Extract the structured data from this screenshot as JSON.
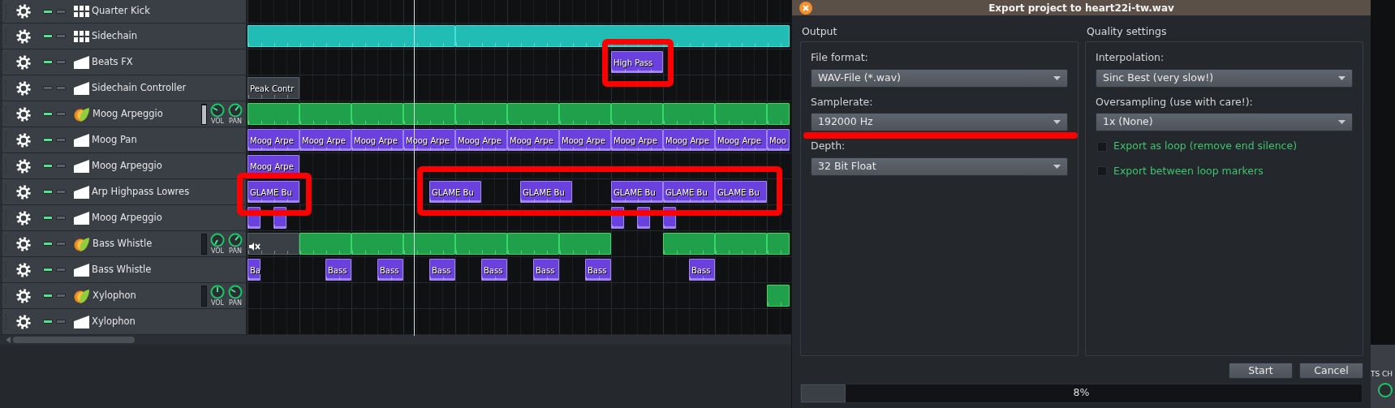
{
  "song_editor": {
    "tracks": [
      {
        "name": "Quarter Kick",
        "kind": "pattern",
        "muted": false,
        "solo": false
      },
      {
        "name": "Sidechain",
        "kind": "pattern",
        "muted": false,
        "solo": false,
        "clips": [
          {
            "kind": "beat"
          },
          {
            "kind": "beat"
          }
        ]
      },
      {
        "name": "Beats FX",
        "kind": "automation",
        "muted": false,
        "solo": false,
        "clips": [
          {
            "kind": "automation",
            "label": "High Pass"
          }
        ]
      },
      {
        "name": "Sidechain Controller",
        "kind": "automation",
        "muted": true,
        "solo": false,
        "clips": [
          {
            "kind": "automation",
            "label": "Peak Contr"
          }
        ]
      },
      {
        "name": "Moog Arpeggio",
        "kind": "instrument",
        "muted": false,
        "solo": false,
        "level": 0.95,
        "knobs": [
          {
            "label": "VOL"
          },
          {
            "label": "PAN"
          }
        ],
        "clips": [
          {
            "kind": "melody"
          },
          {
            "kind": "melody"
          },
          {
            "kind": "melody"
          },
          {
            "kind": "melody"
          },
          {
            "kind": "melody"
          },
          {
            "kind": "melody"
          },
          {
            "kind": "melody"
          },
          {
            "kind": "melody"
          },
          {
            "kind": "melody"
          },
          {
            "kind": "melody"
          },
          {
            "kind": "melody"
          }
        ]
      },
      {
        "name": "Moog Pan",
        "kind": "automation",
        "muted": false,
        "solo": false,
        "clips": [
          {
            "kind": "automation",
            "label": "Moog Arpe"
          },
          {
            "kind": "automation",
            "label": "Moog Arpe"
          },
          {
            "kind": "automation",
            "label": "Moog Arpe"
          },
          {
            "kind": "automation",
            "label": "Moog Arpe"
          },
          {
            "kind": "automation",
            "label": "Moog Arpe"
          },
          {
            "kind": "automation",
            "label": "Moog Arpe"
          },
          {
            "kind": "automation",
            "label": "Moog Arpe"
          },
          {
            "kind": "automation",
            "label": "Moog Arpe"
          },
          {
            "kind": "automation",
            "label": "Moog Arpe"
          },
          {
            "kind": "automation",
            "label": "Moog Arpe"
          },
          {
            "kind": "automation",
            "label": "Moo"
          }
        ]
      },
      {
        "name": "Moog Arpeggio",
        "kind": "automation",
        "muted": false,
        "solo": false,
        "clips": [
          {
            "kind": "automation",
            "label": "Moog Arpe"
          }
        ]
      },
      {
        "name": "Arp Highpass Lowres",
        "kind": "automation",
        "muted": false,
        "solo": false,
        "clips": [
          {
            "kind": "automation",
            "label": "GLAME Bu"
          },
          {
            "kind": "automation",
            "label": "GLAME Bu"
          },
          {
            "kind": "automation",
            "label": "GLAME Bu"
          },
          {
            "kind": "automation",
            "label": "GLAME Bu"
          },
          {
            "kind": "automation",
            "label": "GLAME Bu"
          },
          {
            "kind": "automation",
            "label": "GLAME Bu"
          }
        ]
      },
      {
        "name": "Moog Arpeggio",
        "kind": "automation",
        "muted": false,
        "solo": false,
        "clips": [
          {
            "kind": "automation"
          },
          {
            "kind": "automation"
          },
          {
            "kind": "automation"
          },
          {
            "kind": "automation"
          },
          {
            "kind": "automation"
          }
        ]
      },
      {
        "name": "Bass Whistle",
        "kind": "instrument",
        "muted": false,
        "solo": false,
        "level": 0,
        "knobs": [
          {
            "label": "VOL"
          },
          {
            "label": "PAN"
          }
        ],
        "clips": [
          {
            "kind": "melody",
            "muted": true
          },
          {
            "kind": "melody",
            "muted": false
          },
          {
            "kind": "melody",
            "muted": false
          },
          {
            "kind": "melody",
            "muted": false
          },
          {
            "kind": "melody",
            "muted": false
          },
          {
            "kind": "melody",
            "muted": false
          },
          {
            "kind": "melody",
            "muted": false
          },
          {
            "kind": "melody",
            "muted": false
          },
          {
            "kind": "melody",
            "muted": false
          },
          {
            "kind": "melody",
            "muted": false
          }
        ]
      },
      {
        "name": "Bass Whistle",
        "kind": "automation",
        "muted": false,
        "solo": false,
        "clips": [
          {
            "kind": "automation",
            "label": "Ba"
          },
          {
            "kind": "automation",
            "label": "Bass"
          },
          {
            "kind": "automation",
            "label": "Bass"
          },
          {
            "kind": "automation",
            "label": "Bass"
          },
          {
            "kind": "automation",
            "label": "Bass"
          },
          {
            "kind": "automation",
            "label": "Bass"
          },
          {
            "kind": "automation",
            "label": "Bass"
          },
          {
            "kind": "automation",
            "label": "Bass"
          }
        ]
      },
      {
        "name": "Xylophon",
        "kind": "instrument",
        "muted": false,
        "solo": false,
        "level": 0,
        "knobs": [
          {
            "label": "VOL"
          },
          {
            "label": "PAN"
          }
        ],
        "clips": [
          {
            "kind": "melody"
          }
        ]
      },
      {
        "name": "Xylophon",
        "kind": "automation",
        "muted": false,
        "solo": false
      }
    ]
  },
  "export_dialog": {
    "title": "Export project to heart22i-tw.wav",
    "output": {
      "heading": "Output",
      "fields": [
        {
          "label": "File format:",
          "value": "WAV-File (*.wav)"
        },
        {
          "label": "Samplerate:",
          "value": "192000 Hz"
        },
        {
          "label": "Depth:",
          "value": "32 Bit Float"
        }
      ]
    },
    "quality": {
      "heading": "Quality settings",
      "fields": [
        {
          "label": "Interpolation:",
          "value": "Sinc Best (very slow!)"
        },
        {
          "label": "Oversampling (use with care!):",
          "value": "1x (None)"
        }
      ],
      "options": [
        {
          "label": "Export as loop (remove end silence)",
          "checked": false
        },
        {
          "label": "Export between loop markers",
          "checked": false
        }
      ]
    },
    "buttons": [
      "Start",
      "Cancel"
    ],
    "progress": {
      "level": 0.08,
      "reading": "8%"
    }
  },
  "side_panel": {
    "label": "TS CH"
  },
  "annotations": [
    {
      "kind": "box"
    },
    {
      "kind": "box"
    },
    {
      "kind": "box"
    },
    {
      "kind": "underline"
    }
  ]
}
